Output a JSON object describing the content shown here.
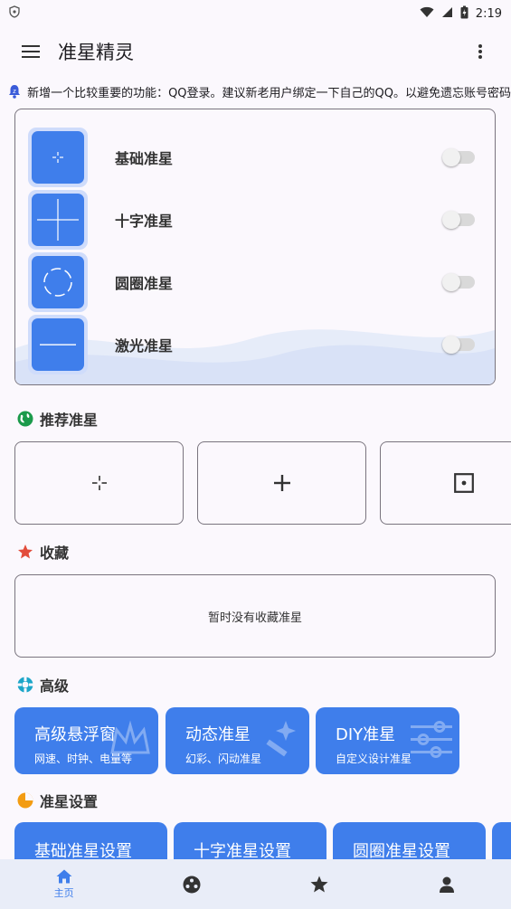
{
  "status_bar": {
    "time": "2:19"
  },
  "app_bar": {
    "title": "准星精灵"
  },
  "notice": {
    "text": "新增一个比较重要的功能：QQ登录。建议新老用户绑定一下自己的QQ。以避免遗忘账号密码"
  },
  "crosshairs": [
    {
      "label": "基础准星",
      "enabled": false,
      "icon": "dot-crosshair-icon"
    },
    {
      "label": "十字准星",
      "enabled": false,
      "icon": "cross-crosshair-icon"
    },
    {
      "label": "圆圈准星",
      "enabled": false,
      "icon": "circle-crosshair-icon"
    },
    {
      "label": "激光准星",
      "enabled": false,
      "icon": "laser-crosshair-icon"
    }
  ],
  "sections": {
    "recommended": "推荐准星",
    "favorites": "收藏",
    "advanced": "高级",
    "settings": "准星设置"
  },
  "favorites": {
    "empty_text": "暂时没有收藏准星"
  },
  "advanced": [
    {
      "title": "高级悬浮窗",
      "subtitle": "网速、时钟、电量等"
    },
    {
      "title": "动态准星",
      "subtitle": "幻彩、闪动准星"
    },
    {
      "title": "DIY准星",
      "subtitle": "自定义设计准星"
    }
  ],
  "settings": [
    {
      "title": "基础准星设置"
    },
    {
      "title": "十字准星设置"
    },
    {
      "title": "圆圈准星设置"
    }
  ],
  "bottom_nav": {
    "home_label": "主页"
  },
  "colors": {
    "accent": "#3f7eeb",
    "thumb_bg": "#cfdcfb",
    "nav_bg": "#e9edf8"
  }
}
